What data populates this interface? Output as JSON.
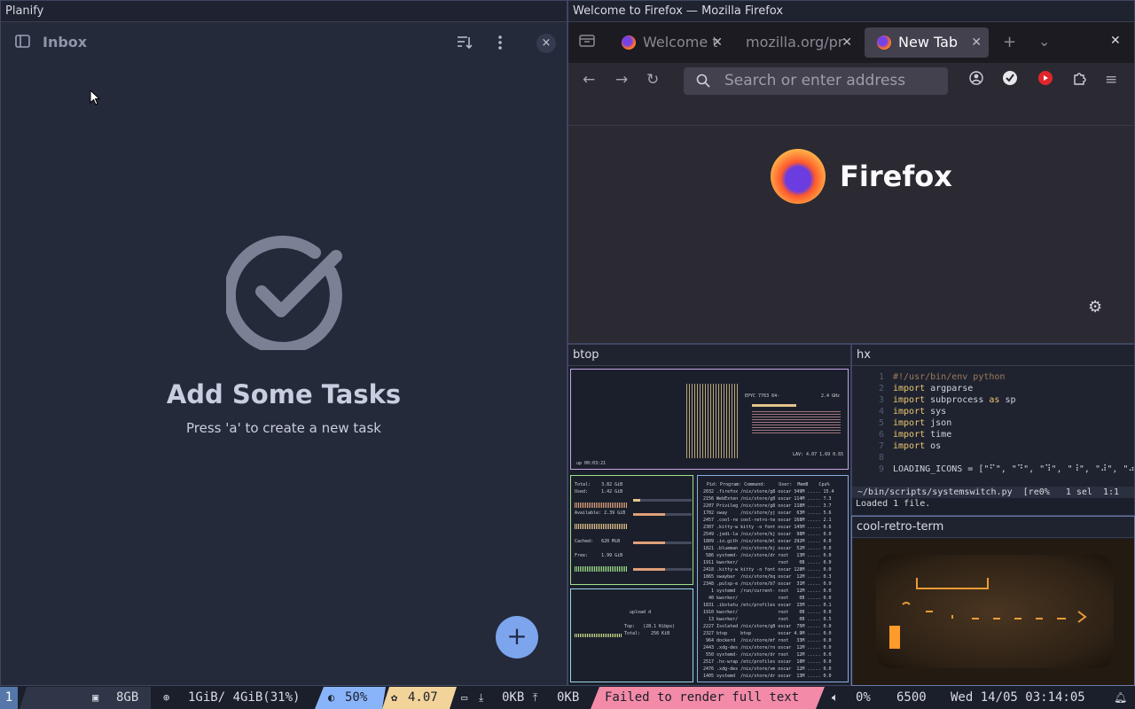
{
  "planify": {
    "window_title": "Planify",
    "header_title": "Inbox",
    "empty_title": "Add Some Tasks",
    "empty_subtitle": "Press 'a' to create a new task",
    "fab_label": "+",
    "close_label": "×"
  },
  "firefox": {
    "window_title": "Welcome to Firefox — Mozilla Firefox",
    "tabs": [
      {
        "label": "Welcome t",
        "active": false
      },
      {
        "label": "mozilla.org/pr",
        "active": false
      },
      {
        "label": "New Tab",
        "active": true
      }
    ],
    "url_placeholder": "Search or enter address",
    "brand": "Firefox"
  },
  "btop": {
    "window_title": "btop",
    "uptime": "up 00:03:21",
    "cpu_model": "EPYC 7763 64-",
    "cpu_freq": "2.4 GHz",
    "lav": "LAV: 4.07 1.69 0.65",
    "mem_total": "Total:    3.82 GiB",
    "mem_used": "Used:     1.42 GiB",
    "mem_avail": "Available: 2.39 GiB",
    "mem_cached": "Cached:   620 MiB",
    "mem_free": "Free:     1.99 GiB",
    "net_upload": "upload d",
    "net_top": "Top:   (28.1 Kibps)",
    "net_total": "Total:    256 KiB",
    "proc_header": "Pid: Program: Command:     User:  MemB    Cpu%",
    "procs": [
      "2032 .firefox /nix/store/g8 oscar 349M ..... 15.4",
      "2156 WebExten /nix/store/g8 oscar 114M ..... 7.3",
      "2207 Privileg /nix/store/g8 oscar 118M ..... 3.7",
      "1702 sway     /nix/store/yj oscar  63M ..... 5.6",
      "2457 .cool-re cool-retro-te oscar 168M ..... 2.1",
      "2307 .kitty-w kitty -o font oscar 145M ..... 0.6",
      "2549 .jedi-la /nix/store/kj oscar  98M ..... 0.0",
      "1809 .io.gith /nix/store/ml oscar 292M ..... 0.0",
      "1821 .blueman /nix/store/bj oscar  52M ..... 0.0",
      " 586 systemd- /nix/store/dr root   13M ..... 0.0",
      "1911 kworker/               root    0B ..... 0.0",
      "2418 .kitty-w kitty -o font oscar 128M ..... 0.0",
      "1865 swaybar  /nix/store/bq oscar  12M ..... 0.3",
      "2348 .pulsp-e /nix/store/b7 oscar  31M ..... 0.0",
      "   1 systemd  /run/current- root   12M ..... 0.0",
      "  40 kworker/               root    0B ..... 0.0",
      "1831 .ibstatu /etc/profiles oscar  15M ..... 0.1",
      "1910 kworker/               root    0B ..... 0.0",
      "  13 kworker/               root    0B ..... 0.5",
      "2227 Isolated /nix/store/g8 oscar  75M ..... 0.0",
      "2327 btop     btop          oscar 4.9M ..... 0.0",
      " 964 dockerd  /nix/store/mf root   33M ..... 0.0",
      "2443 .xdg-des /nix/store/rn oscar  12M ..... 0.0",
      " 550 systemd- /nix/store/dr root   12M ..... 0.0",
      "2517 .hx-wrap /etc/profiles oscar  18M ..... 0.0",
      "2476 .xdg-des /nix/store/vm oscar  12M ..... 0.0",
      "1405 systemd  /nix/store/dr oscar  13M ..... 0.0"
    ]
  },
  "hx": {
    "window_title": "hx",
    "lines": [
      {
        "n": "1",
        "text": "#!/usr/bin/env python"
      },
      {
        "n": "2",
        "kw": "import",
        "text": " argparse"
      },
      {
        "n": "3",
        "kw": "import",
        "text": " subprocess ",
        "kw2": "as",
        "text2": " sp"
      },
      {
        "n": "4",
        "kw": "import",
        "text": " sys"
      },
      {
        "n": "5",
        "kw": "import",
        "text": " json"
      },
      {
        "n": "6",
        "kw": "import",
        "text": " time"
      },
      {
        "n": "7",
        "kw": "import",
        "text": " os"
      },
      {
        "n": "8",
        "text": ""
      },
      {
        "n": "9",
        "text": "LOADING_ICONS = [\"⠋\", \"⠙\", \"⠹\", \"⠸\", \"⠼\", \"⠴\""
      }
    ],
    "status": " ~/bin/scripts/systemswitch.py  [re0%   1 sel  1:1",
    "message": "Loaded 1 file."
  },
  "crt": {
    "window_title": "cool-retro-term"
  },
  "bar": {
    "workspace": "1",
    "ram": "8GB",
    "mem": "1GiB/ 4GiB(31%)",
    "brightness": "50%",
    "load": "4.07",
    "net_down": "0KB",
    "net_up": "0KB",
    "error": "Failed to render full text",
    "volume": "0%",
    "temp": "6500",
    "clock": "Wed 14/05 03:14:05"
  },
  "colors": {
    "bg": "#1b1f2b",
    "planify_bg": "#242a3a",
    "fab": "#7da5ee",
    "accent_blue": "#5577aa",
    "error_pink": "#f38ba8",
    "load_yellow": "#f2d39a",
    "bright_blue": "#89b4fa"
  }
}
